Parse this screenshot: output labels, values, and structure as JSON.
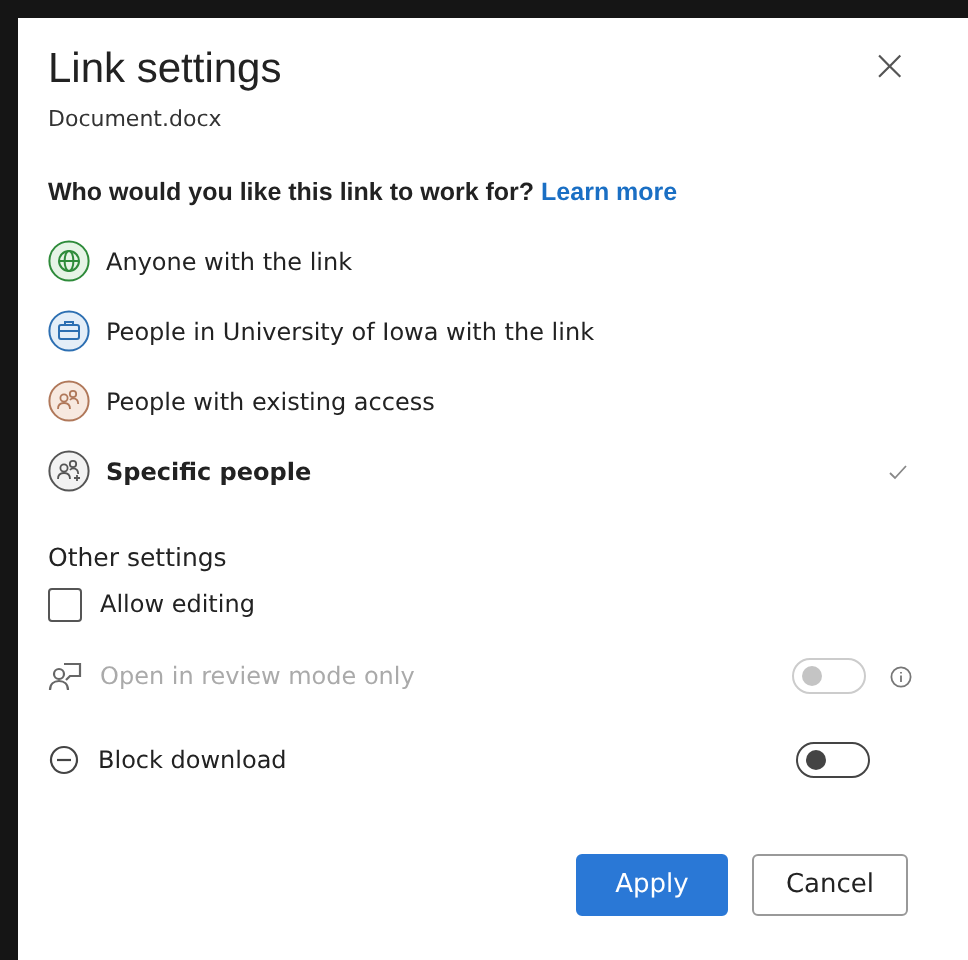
{
  "dialog": {
    "title": "Link settings",
    "subtitle": "Document.docx",
    "close": "×"
  },
  "question": {
    "text": "Who would you like this link to work for?",
    "link": "Learn more"
  },
  "options": [
    {
      "kind": "globe",
      "label": "Anyone with the link",
      "selected": false
    },
    {
      "kind": "organization",
      "label": "People in University of Iowa with the link",
      "selected": false
    },
    {
      "kind": "existing",
      "label": "People with existing access",
      "selected": false
    },
    {
      "kind": "specific",
      "label": "Specific people",
      "selected": true
    }
  ],
  "other_settings": {
    "heading": "Other settings",
    "settings": [
      {
        "kind": "checkbox",
        "label": "Allow editing",
        "checked": false,
        "disabled": false
      },
      {
        "kind": "review",
        "label": "Open in review mode only",
        "on": false,
        "disabled": true,
        "info": true
      },
      {
        "kind": "block",
        "label": "Block download",
        "on": false,
        "disabled": false
      }
    ]
  },
  "buttons": [
    {
      "label": "Apply",
      "primary": true
    },
    {
      "label": "Cancel",
      "primary": false
    }
  ]
}
